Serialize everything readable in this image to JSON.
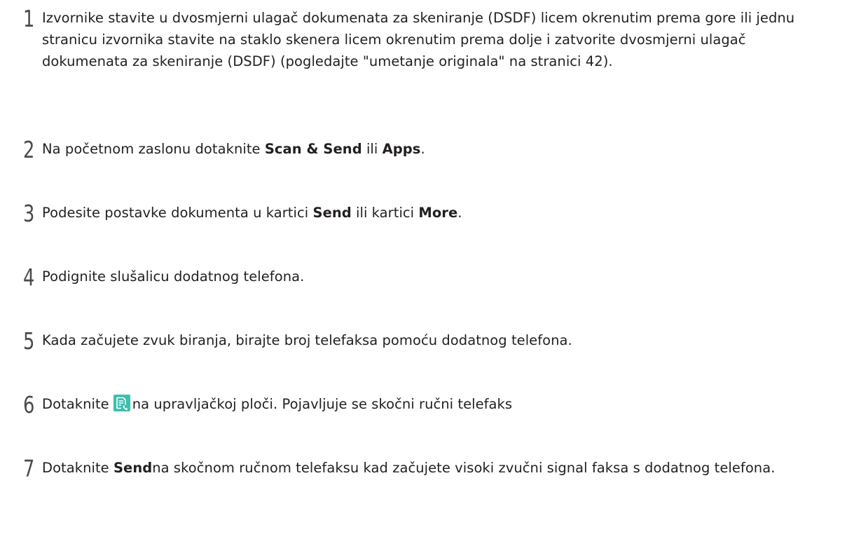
{
  "steps": [
    {
      "number": "1",
      "text": "Izvornike stavite u dvosmjerni ulagač dokumenata za skeniranje (DSDF) licem okrenutim prema gore ili jednu stranicu izvornika stavite na staklo skenera licem okrenutim prema dolje i zatvorite dvosmjerni ulagač dokumenata za skeniranje (DSDF) (pogledajte \"umetanje originala\" na stranici 42)."
    },
    {
      "number": "2",
      "pre": "Na početnom zaslonu dotaknite ",
      "bold1": "Scan & Send",
      "mid": " ili ",
      "bold2": "Apps",
      "post": "."
    },
    {
      "number": "3",
      "pre": "Podesite postavke dokumenta u kartici ",
      "bold1": "Send",
      "mid": " ili kartici ",
      "bold2": "More",
      "post": "."
    },
    {
      "number": "4",
      "text": "Podignite slušalicu dodatnog telefona."
    },
    {
      "number": "5",
      "text": "Kada začujete zvuk biranja, birajte broj telefaksa pomoću dodatnog telefona."
    },
    {
      "number": "6",
      "pre": "Dotaknite",
      "icon": "manual-fax-icon",
      "post": "na upravljačkoj ploči. Pojavljuje se skočni ručni telefaks"
    },
    {
      "number": "7",
      "pre": "Dotaknite ",
      "bold1": "Send",
      "post": "na skočnom ručnom telefaksu kad začujete visoki zvučni signal faksa s dodatnog telefona."
    }
  ],
  "colors": {
    "text": "#231f20",
    "icon_bg": "#3cbfae",
    "icon_fg": "#ffffff"
  }
}
